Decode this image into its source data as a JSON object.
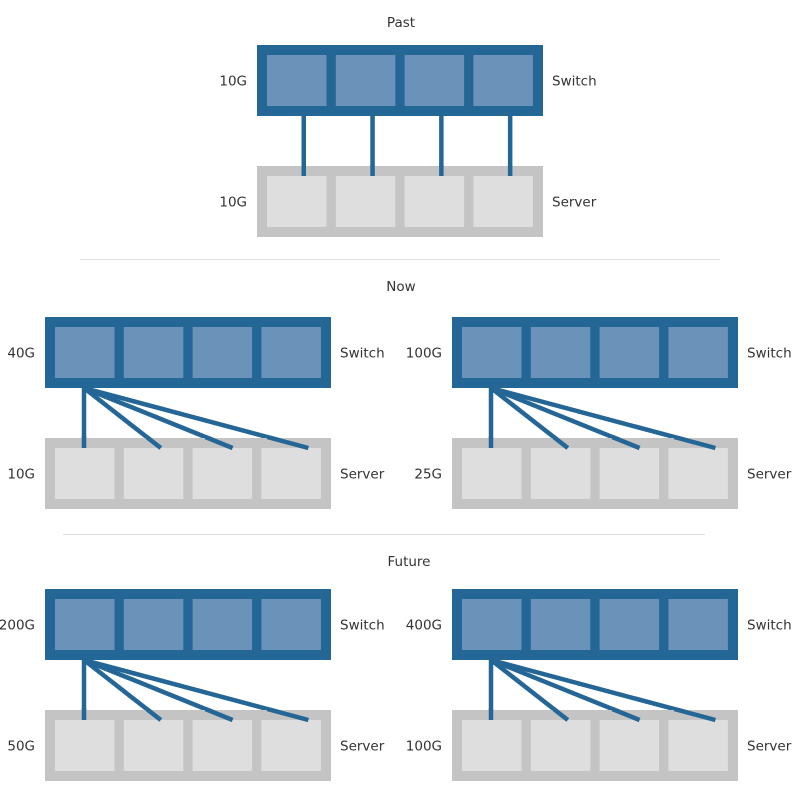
{
  "colors": {
    "switch_frame": "#246696",
    "switch_port": "#6b93b9",
    "server_frame": "#c4c4c4",
    "server_port": "#dedede",
    "link": "#246696",
    "divider": "#dddddd",
    "text": "#333333"
  },
  "sections": [
    {
      "title": "Past",
      "topology": "one-to-one",
      "groups": [
        {
          "switch": {
            "label": "Switch",
            "speed": "10G",
            "ports": 4
          },
          "server": {
            "label": "Server",
            "speed": "10G",
            "ports": 4
          },
          "links": [
            [
              0,
              0
            ],
            [
              1,
              1
            ],
            [
              2,
              2
            ],
            [
              3,
              3
            ]
          ]
        }
      ]
    },
    {
      "title": "Now",
      "topology": "breakout",
      "groups": [
        {
          "switch": {
            "label": "Switch",
            "speed": "40G",
            "ports": 4
          },
          "server": {
            "label": "Server",
            "speed": "10G",
            "ports": 4
          },
          "links": [
            [
              0,
              0
            ],
            [
              0,
              1
            ],
            [
              0,
              2
            ],
            [
              0,
              3
            ]
          ]
        },
        {
          "switch": {
            "label": "Switch",
            "speed": "100G",
            "ports": 4
          },
          "server": {
            "label": "Server",
            "speed": "25G",
            "ports": 4
          },
          "links": [
            [
              0,
              0
            ],
            [
              0,
              1
            ],
            [
              0,
              2
            ],
            [
              0,
              3
            ]
          ]
        }
      ]
    },
    {
      "title": "Future",
      "topology": "breakout",
      "groups": [
        {
          "switch": {
            "label": "Switch",
            "speed": "200G",
            "ports": 4
          },
          "server": {
            "label": "Server",
            "speed": "50G",
            "ports": 4
          },
          "links": [
            [
              0,
              0
            ],
            [
              0,
              1
            ],
            [
              0,
              2
            ],
            [
              0,
              3
            ]
          ]
        },
        {
          "switch": {
            "label": "Switch",
            "speed": "400G",
            "ports": 4
          },
          "server": {
            "label": "Server",
            "speed": "100G",
            "ports": 4
          },
          "links": [
            [
              0,
              0
            ],
            [
              0,
              1
            ],
            [
              0,
              2
            ],
            [
              0,
              3
            ]
          ]
        }
      ]
    }
  ]
}
